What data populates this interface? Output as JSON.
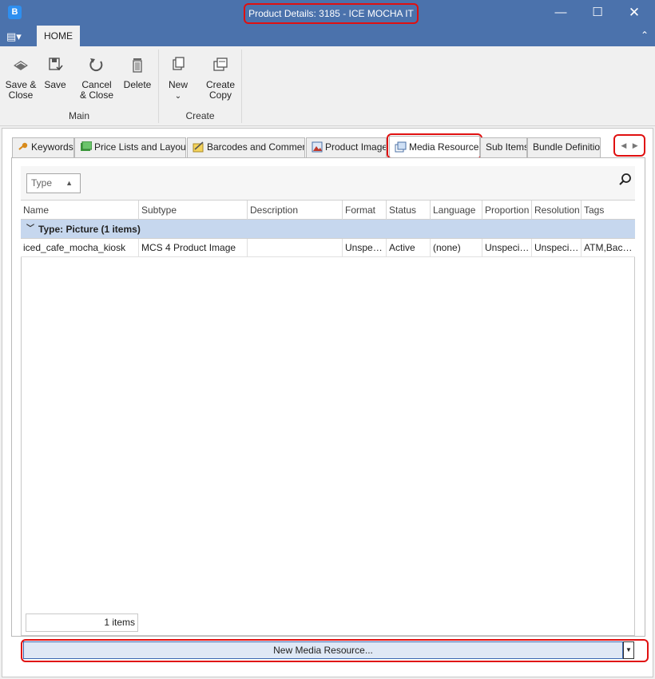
{
  "window": {
    "app_icon_letter": "B",
    "title": "Product Details: 3185 - ICE MOCHA IT",
    "minimize": "—",
    "maximize": "☐",
    "close": "✕"
  },
  "ribbon": {
    "app_menu_glyph": "▤▾",
    "tab": "HOME",
    "collapse_glyph": "⌃",
    "groups": {
      "main": {
        "label": "Main",
        "save_close": "Save &\nClose",
        "save": "Save",
        "cancel_close": "Cancel\n& Close",
        "delete": "Delete"
      },
      "create": {
        "label": "Create",
        "new": "New",
        "new_arrow": "⌄",
        "create_copy": "Create\nCopy"
      }
    }
  },
  "tabs": [
    {
      "label": "Keywords"
    },
    {
      "label": "Price Lists and Layouts"
    },
    {
      "label": "Barcodes and Comments"
    },
    {
      "label": "Product Images"
    },
    {
      "label": "Media Resources"
    },
    {
      "label": "Sub Items"
    },
    {
      "label": "Bundle Definition"
    }
  ],
  "tab_scroll": {
    "left": "◀",
    "right": "▶"
  },
  "grid": {
    "group_chip": "Type",
    "columns": [
      "Name",
      "Subtype",
      "Description",
      "Format",
      "Status",
      "Language",
      "Proportion",
      "Resolution",
      "Tags"
    ],
    "group_row": "Type: Picture (1 items)",
    "rows": [
      {
        "name": "iced_cafe_mocha_kiosk",
        "subtype": "MCS 4 Product Image",
        "description": "",
        "format": "Unspeci...",
        "status": "Active",
        "language": "(none)",
        "proportion": "Unspecifi...",
        "resolution": "Unspecifi...",
        "tags": "ATM,Back ..."
      }
    ],
    "count": "1 items"
  },
  "new_button": {
    "label": "New Media Resource...",
    "dropdown": "▼"
  },
  "colors": {
    "titlebar": "#4b72ac",
    "highlight": "#e01010",
    "group_row": "#c6d7ee"
  }
}
